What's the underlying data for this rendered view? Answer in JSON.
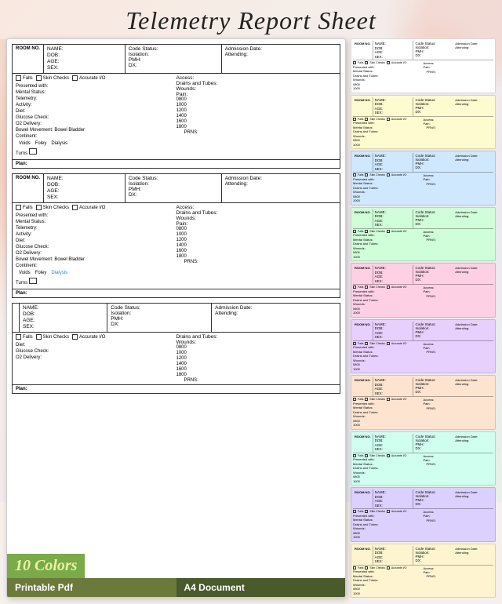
{
  "title": "Telemetry Report Sheet",
  "colors_label": "10 Colors",
  "badge_printable": "Printable Pdf",
  "badge_a4": "A4 Document",
  "form": {
    "room_no": "ROOM NO.",
    "name": "NAME:",
    "dob": "DOB:",
    "age": "AGE:",
    "sex": "SEX:",
    "code_status": "Code Status:",
    "isolation": "Isolation:",
    "pmh": "PMH:",
    "dx": "DX:",
    "admission_date": "Admission Date:",
    "attending": "Attending:",
    "presented_with": "Presented with:",
    "mental_status": "Mental Status:",
    "telemetry": "Telemetry:",
    "activity": "Activity:",
    "diet": "Diet:",
    "glucose_check": "Glucose Check:",
    "o2_delivery": "O2 Delivery:",
    "bowel_movement": "Bowel Movement:",
    "bowel": "Bowel",
    "bladder": "Bladder",
    "continent": "Continent:",
    "voids": "Voids",
    "foley": "Foley",
    "dialysis": "Dialysis",
    "turns": "Turns",
    "access": "Access:",
    "drains_tubes": "Drains and Tubes:",
    "wounds": "Wounds:",
    "pain": "Pain:",
    "falls": "Falls",
    "skin_checks": "Skin Checks",
    "accurate_io": "Accurate I/O",
    "times": [
      "0800",
      "1000",
      "1200",
      "1400",
      "1600",
      "1800"
    ],
    "prns": "PRNS:",
    "plan": "Plan:"
  },
  "color_variants": [
    {
      "id": "white",
      "bg": "#ffffff",
      "label": "White"
    },
    {
      "id": "yellow",
      "bg": "#fefbd0",
      "label": "Yellow"
    },
    {
      "id": "blue",
      "bg": "#d0e8fe",
      "label": "Blue"
    },
    {
      "id": "green",
      "bg": "#d0fed8",
      "label": "Green"
    },
    {
      "id": "pink",
      "bg": "#fed0e4",
      "label": "Pink"
    },
    {
      "id": "purple",
      "bg": "#e8d0fe",
      "label": "Purple"
    },
    {
      "id": "peach",
      "bg": "#fde4d0",
      "label": "Peach"
    },
    {
      "id": "mint",
      "bg": "#d0feef",
      "label": "Mint"
    },
    {
      "id": "lavender",
      "bg": "#dcd0fe",
      "label": "Lavender"
    },
    {
      "id": "cream",
      "bg": "#fef5d0",
      "label": "Cream"
    }
  ]
}
